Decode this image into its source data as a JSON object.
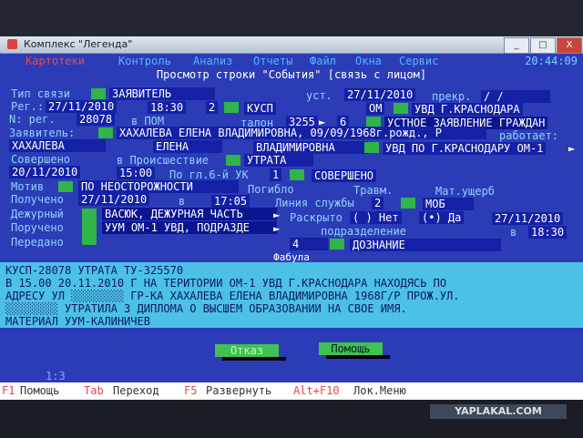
{
  "window": {
    "title": "Комплекс \"Легенда\"",
    "buttons": [
      "_",
      "□",
      "X"
    ]
  },
  "menu": {
    "items": [
      "Картотеки",
      "Контроль",
      "Анализ",
      "Отчеты",
      "Файл",
      "Окна",
      "Сервис"
    ],
    "clock": "20:44:09"
  },
  "dialog_title": "Просмотр строки \"События\" [связь с лицом]",
  "fields": {
    "tip_svyazi_label": "Тип связи",
    "tip_svyazi": "ЗАЯВИТЕЛЬ",
    "ust_label": "уст.",
    "ust": "27/11/2010",
    "prekr_label": "прекр.",
    "prekr": "/  /",
    "reg_label": "Рег.:",
    "reg_date": "27/11/2010",
    "reg_time": "18:30",
    "reg_num": "2",
    "kusp": "КУСП",
    "om": "ОМ",
    "uvd": "УВД Г.КРАСНОДАРА",
    "nreg_label": "N: рег.",
    "nreg": "28078",
    "v_pom": "в ПОМ",
    "talon_label": "талон",
    "talon": "3255",
    "talon_n": "6",
    "ustnoe": "УСТНОЕ ЗАЯВЛЕНИЕ ГРАЖДАН",
    "zayavitel_label": "Заявитель:",
    "zayavitel": "ХАХАЛЕВА ЕЛЕНА ВЛАДИМИРОВНА, 09/09/1968г.рожд., Р",
    "rabotaet": "работает:",
    "familiya": "ХАХАЛЕВА",
    "imya": "ЕЛЕНА",
    "otchestvo": "ВЛАДИМИРОВНА",
    "uvd_om": "УВД ПО Г.КРАСНОДАРУ ОМ-1",
    "soversheno_label": "Совершено",
    "v_proisshestvii": "в Происшествие",
    "utrata": "УТРАТА",
    "date2": "20/11/2010",
    "time2": "15:00",
    "po_gl": "По гл.6-й УК",
    "gl_num": "1",
    "soversheno": "СОВЕРШЕНО",
    "motiv_label": "Мотив",
    "motiv": "ПО НЕОСТОРОЖНОСТИ",
    "pogiblo": "Погибло",
    "travm": "Травм.",
    "mat_usherb": "Мат.ущерб",
    "polucheno_label": "Получено",
    "polucheno_date": "27/11/2010",
    "v": "в",
    "polucheno_time": "17:05",
    "liniya_label": "Линия службы",
    "liniya": "2",
    "mob": "МОБ",
    "dezhurny_label": "Дежурный",
    "dezhurny": "ВАСЮК, ДЕЖУРНАЯ ЧАСТЬ",
    "raskryto_label": "Раскрыто",
    "net": "( ) Нет",
    "da": "(•) Да",
    "raskryto_date": "27/11/2010",
    "porucheno_label": "Поручено",
    "porucheno": "УУМ ОМ-1 УВД, ПОДРАЗДЕ",
    "podrazdelenie_label": "подразделение",
    "v2": "в",
    "time3": "18:30",
    "peredano_label": "Передано",
    "podr_num": "4",
    "doznanie": "ДОЗНАНИЕ"
  },
  "fabula": {
    "label": "Фабула",
    "lines": [
      "КУСП-28078 УТРАТА ТУ-325570",
      "В 15.00 20.11.2010 Г НА ТЕРИТОРИИ ОМ-1 УВД Г.КРАСНОДАРА НАХОДЯСЬ ПО",
      "АДРЕСУ УЛ ░░░░░░░░ ГР-КА ХАХАЛЕВА ЕЛЕНА ВЛАДИМИРОВНА 1968Г/Р ПРОЖ.УЛ.",
      "░░░░░░░░ УТРАТИЛА З ДИПЛОМА О ВЫСШЕМ ОБРАЗОВАНИИ НА СВОЕ ИМЯ.",
      "МАТЕРИАЛ УУМ-КАЛИНИЧЕВ"
    ]
  },
  "buttons": {
    "cancel": "Отказ",
    "help": "Помощь"
  },
  "footer": {
    "page": "1:3",
    "f1_key": "F1",
    "f1": "Помощь",
    "tab_key": "Tab",
    "tab": "Переход",
    "f5_key": "F5",
    "f5": "Развернуть",
    "altf10_key": "Alt+F10",
    "altf10": "Лок.Меню"
  },
  "watermark": "YAPLAKAL.COM",
  "colors": {
    "dos_bg": "#2b3cb6",
    "fabula_bg": "#4dc0e6",
    "field_green": "#2fb548"
  }
}
